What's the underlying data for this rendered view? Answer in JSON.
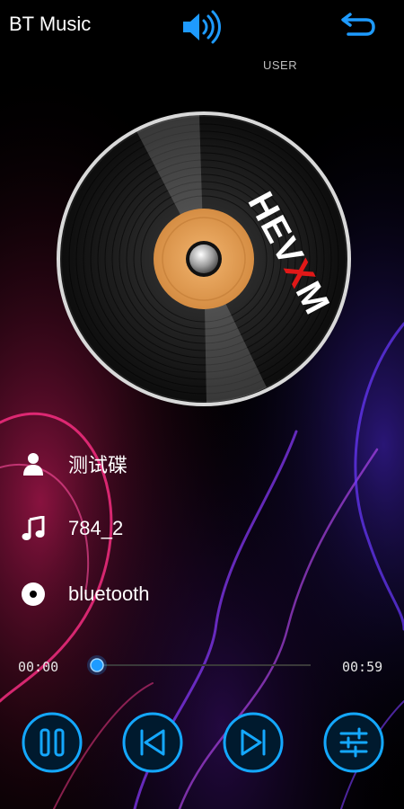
{
  "header": {
    "title": "BT Music",
    "volume_icon": "speaker-icon",
    "back_icon": "return-arrow-icon",
    "eq_preset": "USER"
  },
  "disc": {
    "brand": "HEVXM",
    "accent": "#e8a35a"
  },
  "track": {
    "artist": "测试碟",
    "title": "784_2",
    "album": "bluetooth"
  },
  "progress": {
    "elapsed": "00:00",
    "total": "00:59",
    "fraction": 0.0
  },
  "controls": [
    {
      "name": "pause-button",
      "icon": "pause-icon"
    },
    {
      "name": "previous-button",
      "icon": "skip-previous-icon"
    },
    {
      "name": "next-button",
      "icon": "skip-next-icon"
    },
    {
      "name": "equalizer-button",
      "icon": "equalizer-icon"
    }
  ],
  "colors": {
    "accent": "#1e9bff",
    "ring": "#14a8ff"
  }
}
